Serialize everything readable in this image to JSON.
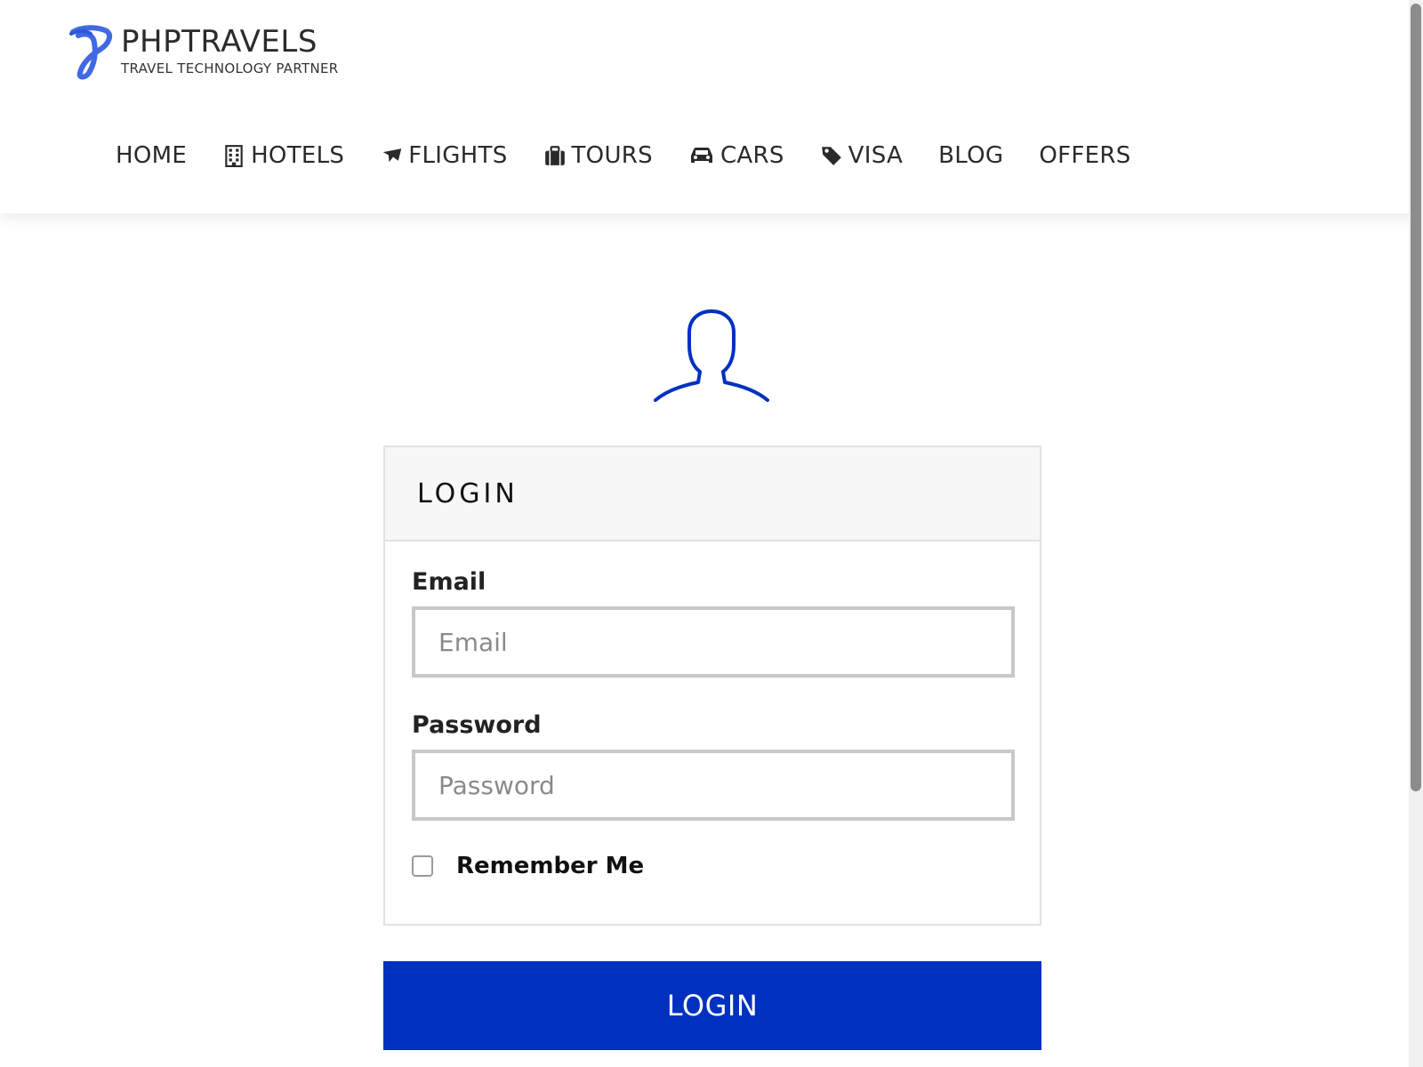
{
  "brand": {
    "name": "PHPTRAVELS",
    "tagline": "TRAVEL TECHNOLOGY PARTNER",
    "accent_color": "#4169e1"
  },
  "nav": {
    "items": [
      {
        "label": "HOME",
        "icon": null
      },
      {
        "label": "HOTELS",
        "icon": "building-icon"
      },
      {
        "label": "FLIGHTS",
        "icon": "plane-icon"
      },
      {
        "label": "TOURS",
        "icon": "suitcase-icon"
      },
      {
        "label": "CARS",
        "icon": "car-icon"
      },
      {
        "label": "VISA",
        "icon": "tag-icon"
      },
      {
        "label": "BLOG",
        "icon": null
      },
      {
        "label": "OFFERS",
        "icon": null
      }
    ]
  },
  "login": {
    "avatar_icon": "user-silhouette-icon",
    "title": "LOGIN",
    "email_label": "Email",
    "email_placeholder": "Email",
    "email_value": "",
    "password_label": "Password",
    "password_placeholder": "Password",
    "password_value": "",
    "remember_label": "Remember Me",
    "remember_checked": false,
    "submit_label": "LOGIN",
    "primary_color": "#0030c0"
  }
}
